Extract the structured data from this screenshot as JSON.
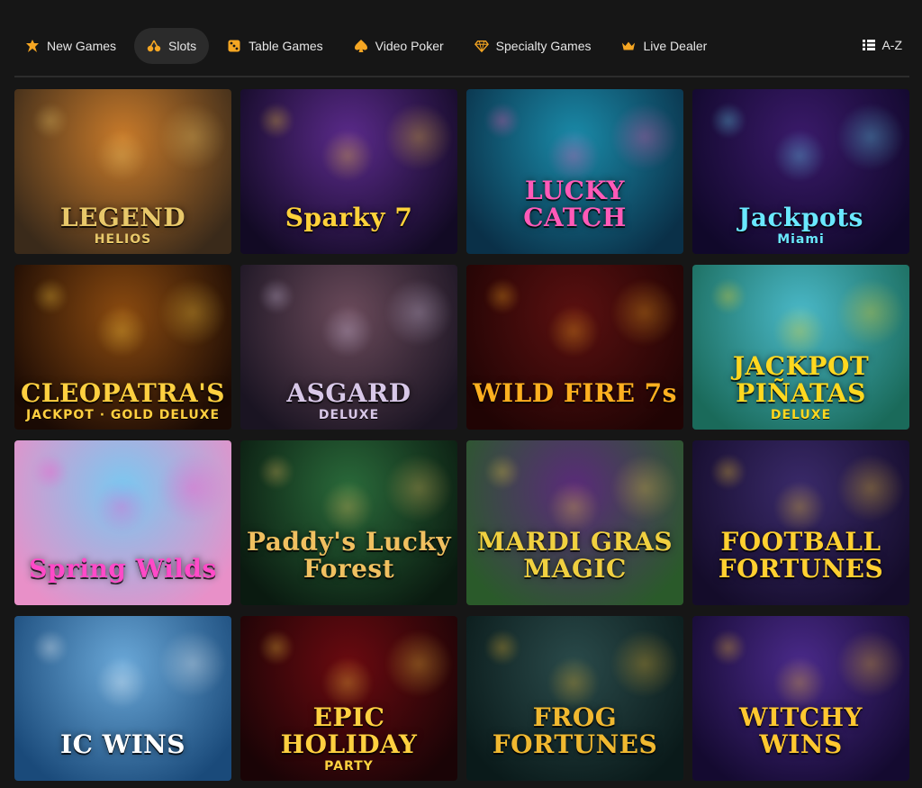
{
  "nav": {
    "items": [
      {
        "label": "New Games",
        "icon": "new-games-icon",
        "active": false
      },
      {
        "label": "Slots",
        "icon": "cherries-icon",
        "active": true
      },
      {
        "label": "Table Games",
        "icon": "dice-icon",
        "active": false
      },
      {
        "label": "Video Poker",
        "icon": "spade-icon",
        "active": false
      },
      {
        "label": "Specialty Games",
        "icon": "diamond-icon",
        "active": false
      },
      {
        "label": "Live Dealer",
        "icon": "crown-icon",
        "active": false
      }
    ],
    "az_label": "A-Z",
    "az_icon": "list-icon"
  },
  "games": [
    {
      "title": "LEGEND",
      "subtitle": "HELIOS",
      "bg1": "#c87a2a",
      "bg2": "#3a2a1a",
      "color": "#e8c86a"
    },
    {
      "title": "Sparky 7",
      "subtitle": "",
      "bg1": "#5a2a8a",
      "bg2": "#120a24",
      "color": "#ffd23a"
    },
    {
      "title": "LUCKY CATCH",
      "subtitle": "",
      "bg1": "#1a8aa8",
      "bg2": "#0a3048",
      "color": "#ff5ab8"
    },
    {
      "title": "Jackpots",
      "subtitle": "Miami",
      "bg1": "#3a1a6a",
      "bg2": "#10082a",
      "color": "#6ae8ff"
    },
    {
      "title": "CLEOPATRA'S",
      "subtitle": "JACKPOT · GOLD DELUXE",
      "bg1": "#8a4a10",
      "bg2": "#1a0a04",
      "color": "#ffd040"
    },
    {
      "title": "ASGARD",
      "subtitle": "DELUXE",
      "bg1": "#6a4a5a",
      "bg2": "#1a1422",
      "color": "#d8c8e8"
    },
    {
      "title": "WILD FIRE 7s",
      "subtitle": "",
      "bg1": "#5a1010",
      "bg2": "#200404",
      "color": "#ffb020"
    },
    {
      "title": "JACKPOT PIÑATAS",
      "subtitle": "DELUXE",
      "bg1": "#4ab8c8",
      "bg2": "#1a6a5a",
      "color": "#ffd820"
    },
    {
      "title": "Spring Wilds",
      "subtitle": "",
      "bg1": "#7ac8f0",
      "bg2": "#e890c8",
      "color": "#ff4ac8"
    },
    {
      "title": "Paddy's Lucky Forest",
      "subtitle": "",
      "bg1": "#2a6a3a",
      "bg2": "#0a1a10",
      "color": "#f0c060"
    },
    {
      "title": "MARDI GRAS MAGIC",
      "subtitle": "",
      "bg1": "#5a2a7a",
      "bg2": "#2a5a2a",
      "color": "#f0d040"
    },
    {
      "title": "FOOTBALL FORTUNES",
      "subtitle": "",
      "bg1": "#3a2a6a",
      "bg2": "#140c2a",
      "color": "#ffd030"
    },
    {
      "title": "IC WINS",
      "subtitle": "",
      "bg1": "#6aa8d8",
      "bg2": "#1a4a7a",
      "color": "#ffffff"
    },
    {
      "title": "EPIC HOLIDAY",
      "subtitle": "PARTY",
      "bg1": "#6a0a10",
      "bg2": "#1a0406",
      "color": "#ffd040"
    },
    {
      "title": "FROG FORTUNES",
      "subtitle": "",
      "bg1": "#2a4a4a",
      "bg2": "#0a1a1a",
      "color": "#f0b830"
    },
    {
      "title": "WITCHY WINS",
      "subtitle": "",
      "bg1": "#4a2a8a",
      "bg2": "#140a30",
      "color": "#ffc830"
    }
  ]
}
